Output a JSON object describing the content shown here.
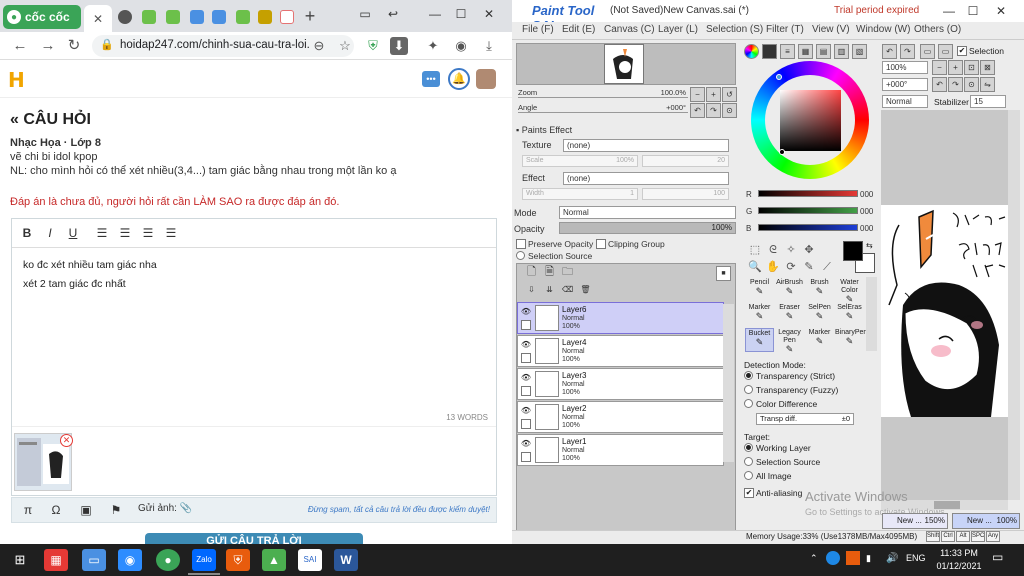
{
  "browser": {
    "logo_text": "cốc cốc",
    "active_tab_icon": "globe-icon",
    "new_tab": "+",
    "url": "hoidap247.com/chinh-sua-cau-tra-loi...",
    "window_minimize": "—",
    "window_maximize": "☐",
    "window_close": "✕"
  },
  "site": {
    "logo": "H",
    "chat_icon": "chat-icon",
    "bell_icon": "bell-icon"
  },
  "question": {
    "title": "CÂU HỎI",
    "subject": "Nhạc Họa · Lớp 8",
    "line1": "vẽ chi bi idol kpop",
    "line2": "NL: cho mình hỏi có thể xét nhiều(3,4...) tam giác bằng nhau trong một lần ko ạ",
    "warning": "Đáp án là chưa đủ, người hỏi rất cần LÀM SAO ra được đáp án đó."
  },
  "editor": {
    "toolbar": [
      "B",
      "I",
      "U"
    ],
    "text_line1": "ko đc xét nhiều tam giác nha",
    "text_line2": "xét 2 tam giác đc nhất",
    "word_count": "13 WORDS"
  },
  "answer_bar": {
    "pi": "π",
    "omega": "Ω",
    "send_image_label": "Gửi ảnh:",
    "note": "Đừng spam, tất cả câu trả lời đều được kiểm duyệt!",
    "submit": "GỬI CÂU TRẢ LỜI"
  },
  "sai": {
    "logo": "Paint Tool SAI",
    "doc_title": "(Not Saved)New Canvas.sai (*)",
    "trial": "Trial period expired",
    "menu": [
      "File (F)",
      "Edit (E)",
      "Canvas (C)",
      "Layer (L)",
      "Selection (S)",
      "Filter (T)",
      "View (V)",
      "Window (W)",
      "Others (O)"
    ],
    "zoom_label": "Zoom",
    "zoom_value": "100.0%",
    "angle_label": "Angle",
    "angle_value": "+000°",
    "paints_effect": "Paints Effect",
    "texture_label": "Texture",
    "texture_value": "(none)",
    "scale_label": "Scale",
    "scale_value": "100%",
    "scale_num": "20",
    "effect_label": "Effect",
    "effect_value": "(none)",
    "width_label": "Width",
    "width_value": "1",
    "width_num": "100",
    "mode_label": "Mode",
    "mode_value": "Normal",
    "opacity_label": "Opacity",
    "opacity_value": "100%",
    "preserve_opacity": "Preserve Opacity",
    "clipping_group": "Clipping Group",
    "selection_source": "Selection Source",
    "layers": [
      {
        "name": "Layer6",
        "mode": "Normal",
        "opacity": "100%",
        "selected": true
      },
      {
        "name": "Layer4",
        "mode": "Normal",
        "opacity": "100%",
        "selected": false
      },
      {
        "name": "Layer3",
        "mode": "Normal",
        "opacity": "100%",
        "selected": false
      },
      {
        "name": "Layer2",
        "mode": "Normal",
        "opacity": "100%",
        "selected": false
      },
      {
        "name": "Layer1",
        "mode": "Normal",
        "opacity": "100%",
        "selected": false
      }
    ],
    "rgb": [
      {
        "label": "R",
        "value": "000",
        "color": "#e53935"
      },
      {
        "label": "G",
        "value": "000",
        "color": "#43a047"
      },
      {
        "label": "B",
        "value": "000",
        "color": "#1e3fd8"
      }
    ],
    "tools": [
      {
        "label": "Pencil",
        "selected": false
      },
      {
        "label": "AirBrush",
        "selected": false
      },
      {
        "label": "Brush",
        "selected": false
      },
      {
        "label": "Water Color",
        "selected": false
      },
      {
        "label": "Marker",
        "selected": false
      },
      {
        "label": "Eraser",
        "selected": false
      },
      {
        "label": "SelPen",
        "selected": false
      },
      {
        "label": "SelEras",
        "selected": false
      },
      {
        "label": "Bucket",
        "selected": true
      },
      {
        "label": "Legacy Pen",
        "selected": false
      },
      {
        "label": "Marker",
        "selected": false
      },
      {
        "label": "BinaryPen",
        "selected": false
      }
    ],
    "detection_mode": "Detection Mode:",
    "detection_options": [
      "Transparency (Strict)",
      "Transparency (Fuzzy)",
      "Color Difference"
    ],
    "transp_diff_label": "Transp diff.",
    "transp_diff_value": "±0",
    "target_label": "Target:",
    "target_options": [
      "Working Layer",
      "Selection Source",
      "All Image"
    ],
    "anti_aliasing": "Anti-aliasing",
    "selection_chk": "Selection",
    "canvas_zoom": "100%",
    "canvas_angle": "+000°",
    "blend_mode": "Normal",
    "stabilizer_label": "Stabilizer",
    "stabilizer_value": "15",
    "canvas_tabs": [
      {
        "name": "New ...",
        "zoom": "150%"
      },
      {
        "name": "New ...",
        "zoom": "100%"
      }
    ],
    "memory_usage": "Memory Usage:33% (Use1378MB/Max4095MB)",
    "status_keys": [
      "Shift",
      "Ctrl",
      "Alt",
      "SPC",
      "Any"
    ]
  },
  "watermark": {
    "line1": "Activate Windows",
    "line2": "Go to Settings to activate Windows."
  },
  "taskbar": {
    "lang": "ENG",
    "time": "11:33 PM",
    "date": "01/12/2021"
  }
}
